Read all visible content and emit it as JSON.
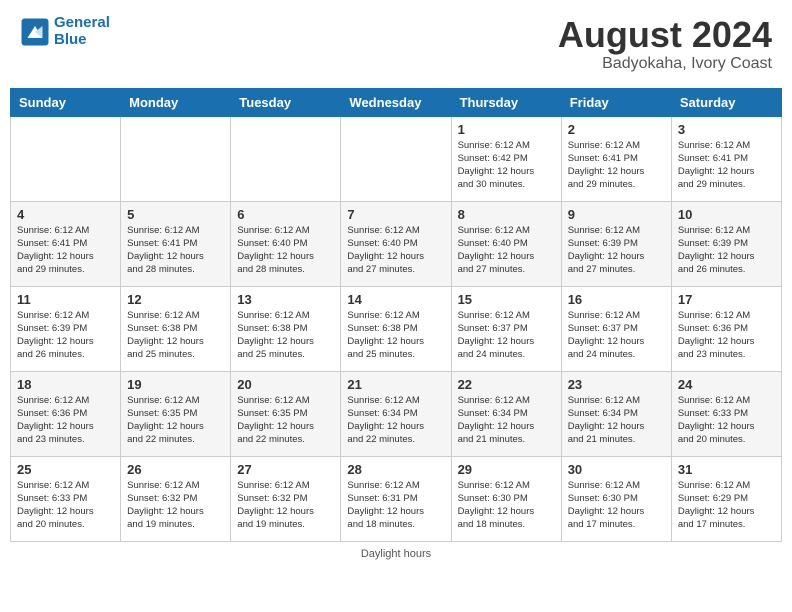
{
  "header": {
    "logo_line1": "General",
    "logo_line2": "Blue",
    "month": "August 2024",
    "location": "Badyokaha, Ivory Coast"
  },
  "weekdays": [
    "Sunday",
    "Monday",
    "Tuesday",
    "Wednesday",
    "Thursday",
    "Friday",
    "Saturday"
  ],
  "weeks": [
    [
      {
        "day": "",
        "info": ""
      },
      {
        "day": "",
        "info": ""
      },
      {
        "day": "",
        "info": ""
      },
      {
        "day": "",
        "info": ""
      },
      {
        "day": "1",
        "info": "Sunrise: 6:12 AM\nSunset: 6:42 PM\nDaylight: 12 hours\nand 30 minutes."
      },
      {
        "day": "2",
        "info": "Sunrise: 6:12 AM\nSunset: 6:41 PM\nDaylight: 12 hours\nand 29 minutes."
      },
      {
        "day": "3",
        "info": "Sunrise: 6:12 AM\nSunset: 6:41 PM\nDaylight: 12 hours\nand 29 minutes."
      }
    ],
    [
      {
        "day": "4",
        "info": "Sunrise: 6:12 AM\nSunset: 6:41 PM\nDaylight: 12 hours\nand 29 minutes."
      },
      {
        "day": "5",
        "info": "Sunrise: 6:12 AM\nSunset: 6:41 PM\nDaylight: 12 hours\nand 28 minutes."
      },
      {
        "day": "6",
        "info": "Sunrise: 6:12 AM\nSunset: 6:40 PM\nDaylight: 12 hours\nand 28 minutes."
      },
      {
        "day": "7",
        "info": "Sunrise: 6:12 AM\nSunset: 6:40 PM\nDaylight: 12 hours\nand 27 minutes."
      },
      {
        "day": "8",
        "info": "Sunrise: 6:12 AM\nSunset: 6:40 PM\nDaylight: 12 hours\nand 27 minutes."
      },
      {
        "day": "9",
        "info": "Sunrise: 6:12 AM\nSunset: 6:39 PM\nDaylight: 12 hours\nand 27 minutes."
      },
      {
        "day": "10",
        "info": "Sunrise: 6:12 AM\nSunset: 6:39 PM\nDaylight: 12 hours\nand 26 minutes."
      }
    ],
    [
      {
        "day": "11",
        "info": "Sunrise: 6:12 AM\nSunset: 6:39 PM\nDaylight: 12 hours\nand 26 minutes."
      },
      {
        "day": "12",
        "info": "Sunrise: 6:12 AM\nSunset: 6:38 PM\nDaylight: 12 hours\nand 25 minutes."
      },
      {
        "day": "13",
        "info": "Sunrise: 6:12 AM\nSunset: 6:38 PM\nDaylight: 12 hours\nand 25 minutes."
      },
      {
        "day": "14",
        "info": "Sunrise: 6:12 AM\nSunset: 6:38 PM\nDaylight: 12 hours\nand 25 minutes."
      },
      {
        "day": "15",
        "info": "Sunrise: 6:12 AM\nSunset: 6:37 PM\nDaylight: 12 hours\nand 24 minutes."
      },
      {
        "day": "16",
        "info": "Sunrise: 6:12 AM\nSunset: 6:37 PM\nDaylight: 12 hours\nand 24 minutes."
      },
      {
        "day": "17",
        "info": "Sunrise: 6:12 AM\nSunset: 6:36 PM\nDaylight: 12 hours\nand 23 minutes."
      }
    ],
    [
      {
        "day": "18",
        "info": "Sunrise: 6:12 AM\nSunset: 6:36 PM\nDaylight: 12 hours\nand 23 minutes."
      },
      {
        "day": "19",
        "info": "Sunrise: 6:12 AM\nSunset: 6:35 PM\nDaylight: 12 hours\nand 22 minutes."
      },
      {
        "day": "20",
        "info": "Sunrise: 6:12 AM\nSunset: 6:35 PM\nDaylight: 12 hours\nand 22 minutes."
      },
      {
        "day": "21",
        "info": "Sunrise: 6:12 AM\nSunset: 6:34 PM\nDaylight: 12 hours\nand 22 minutes."
      },
      {
        "day": "22",
        "info": "Sunrise: 6:12 AM\nSunset: 6:34 PM\nDaylight: 12 hours\nand 21 minutes."
      },
      {
        "day": "23",
        "info": "Sunrise: 6:12 AM\nSunset: 6:34 PM\nDaylight: 12 hours\nand 21 minutes."
      },
      {
        "day": "24",
        "info": "Sunrise: 6:12 AM\nSunset: 6:33 PM\nDaylight: 12 hours\nand 20 minutes."
      }
    ],
    [
      {
        "day": "25",
        "info": "Sunrise: 6:12 AM\nSunset: 6:33 PM\nDaylight: 12 hours\nand 20 minutes."
      },
      {
        "day": "26",
        "info": "Sunrise: 6:12 AM\nSunset: 6:32 PM\nDaylight: 12 hours\nand 19 minutes."
      },
      {
        "day": "27",
        "info": "Sunrise: 6:12 AM\nSunset: 6:32 PM\nDaylight: 12 hours\nand 19 minutes."
      },
      {
        "day": "28",
        "info": "Sunrise: 6:12 AM\nSunset: 6:31 PM\nDaylight: 12 hours\nand 18 minutes."
      },
      {
        "day": "29",
        "info": "Sunrise: 6:12 AM\nSunset: 6:30 PM\nDaylight: 12 hours\nand 18 minutes."
      },
      {
        "day": "30",
        "info": "Sunrise: 6:12 AM\nSunset: 6:30 PM\nDaylight: 12 hours\nand 17 minutes."
      },
      {
        "day": "31",
        "info": "Sunrise: 6:12 AM\nSunset: 6:29 PM\nDaylight: 12 hours\nand 17 minutes."
      }
    ]
  ],
  "footer": "Daylight hours"
}
